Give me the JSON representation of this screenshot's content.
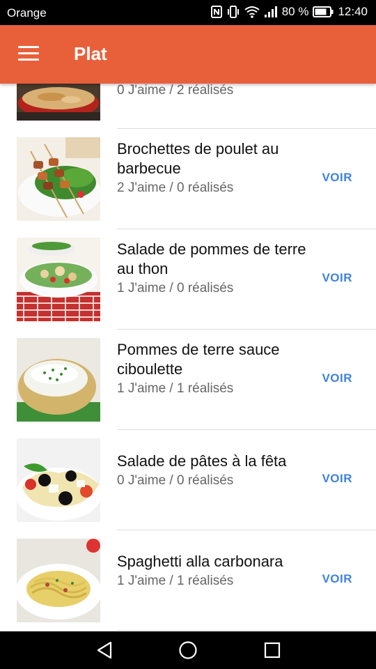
{
  "status_bar": {
    "carrier": "Orange",
    "battery": "80 %",
    "time": "12:40",
    "icons": [
      "nfc-icon",
      "vibrate-icon",
      "wifi-icon",
      "signal-icon",
      "battery-icon"
    ]
  },
  "app_bar": {
    "title": "Plat",
    "menu_icon": "menu-icon",
    "color": "#E8603A"
  },
  "recipes": [
    {
      "name": "",
      "meta": "0 J'aime / 2 réalisés",
      "action": ""
    },
    {
      "name": "Brochettes de poulet au barbecue",
      "meta": "2 J'aime / 0 réalisés",
      "action": "VOIR"
    },
    {
      "name": "Salade de pommes de terre au thon",
      "meta": "1 J'aime / 0 réalisés",
      "action": "VOIR"
    },
    {
      "name": "Pommes de terre sauce ciboulette",
      "meta": "1 J'aime / 1 réalisés",
      "action": "VOIR"
    },
    {
      "name": "Salade de pâtes à la fêta",
      "meta": "0 J'aime / 0 réalisés",
      "action": "VOIR"
    },
    {
      "name": "Spaghetti alla carbonara",
      "meta": "1 J'aime / 1 réalisés",
      "action": "VOIR"
    }
  ],
  "nav_bar": {
    "buttons": [
      "back-icon",
      "home-icon",
      "recents-icon"
    ]
  },
  "accent_color": "#3D82E0"
}
